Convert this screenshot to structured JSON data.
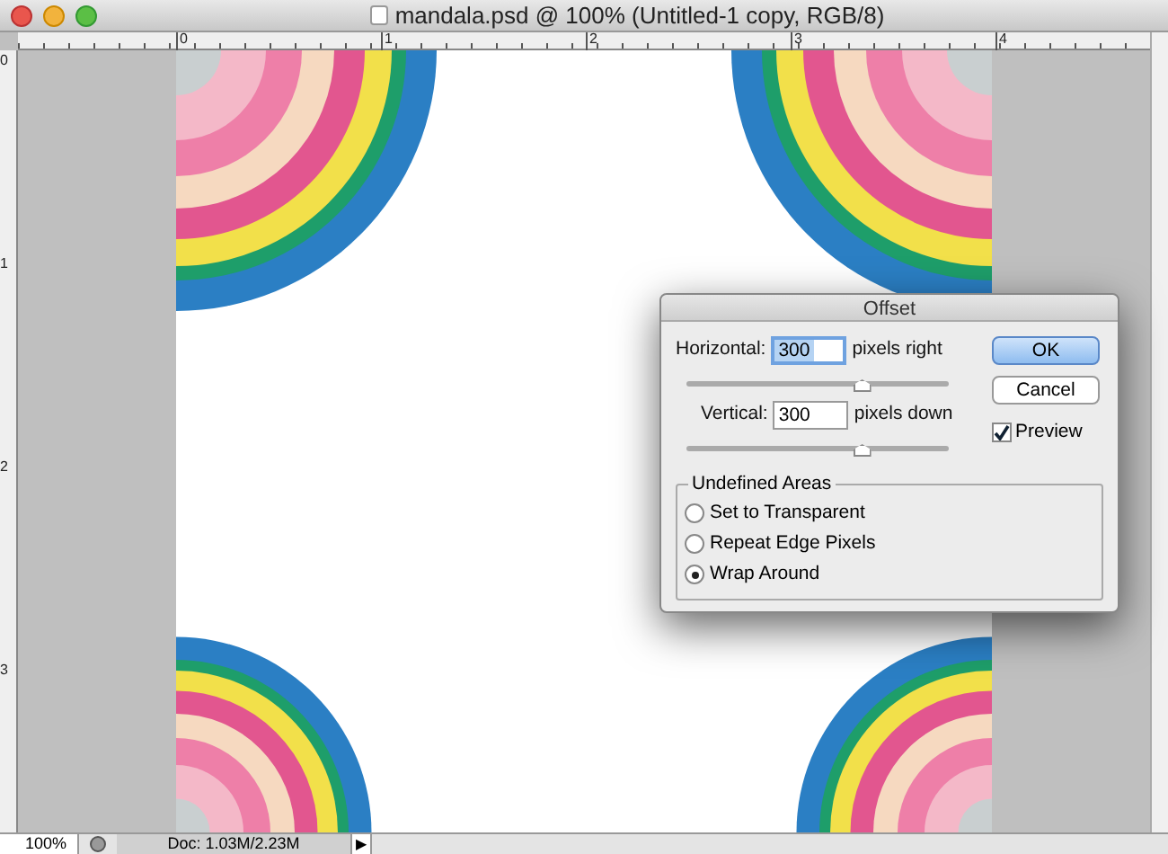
{
  "window": {
    "title": "mandala.psd @ 100% (Untitled-1 copy, RGB/8)"
  },
  "top_ruler": {
    "labels": [
      "0",
      "1",
      "2",
      "3",
      "4"
    ]
  },
  "left_ruler": {
    "labels": [
      "0",
      "1",
      "2",
      "3"
    ]
  },
  "dialog": {
    "title": "Offset",
    "fields": [
      {
        "label": "Horizontal:",
        "value": "300",
        "unit": "pixels right",
        "focused": true,
        "level": 0.67
      },
      {
        "label": "Vertical:",
        "value": "300",
        "unit": "pixels down",
        "focused": false,
        "level": 0.67
      }
    ],
    "buttons": [
      {
        "label": "OK",
        "default": true
      },
      {
        "label": "Cancel",
        "default": false
      }
    ],
    "preview": {
      "label": "Preview",
      "checked": true
    },
    "group": {
      "title": "Undefined Areas",
      "options": [
        {
          "label": "Set to Transparent",
          "selected": false
        },
        {
          "label": "Repeat Edge Pixels",
          "selected": false
        },
        {
          "label": "Wrap Around",
          "selected": true
        }
      ]
    }
  },
  "status_bar": {
    "zoom": "100%",
    "doc": "Doc: 1.03M/2.23M",
    "arrow": "▶"
  }
}
